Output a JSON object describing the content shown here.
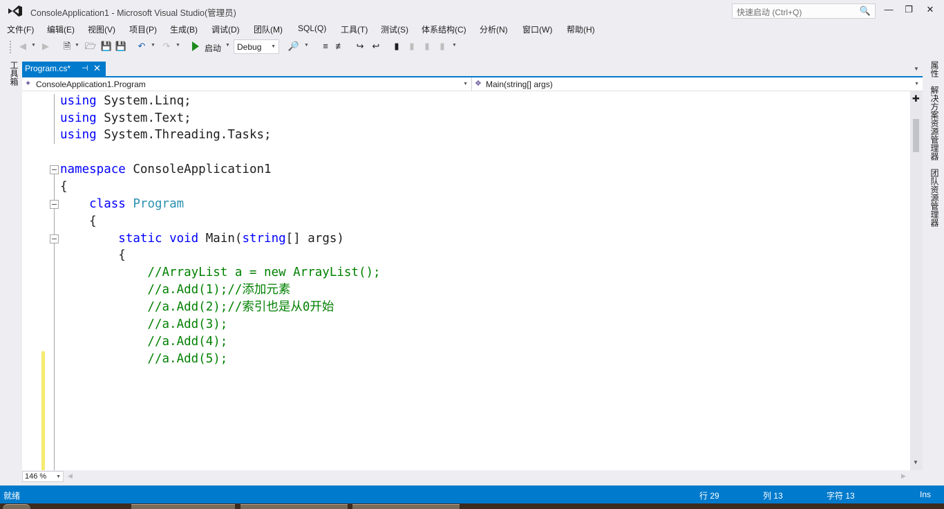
{
  "window": {
    "title": "ConsoleApplication1 - Microsoft Visual Studio(管理员)",
    "quick_launch_placeholder": "快速启动 (Ctrl+Q)",
    "minimize": "—",
    "maximize": "❐",
    "close": "✕"
  },
  "menu": [
    "文件(F)",
    "编辑(E)",
    "视图(V)",
    "项目(P)",
    "生成(B)",
    "调试(D)",
    "团队(M)",
    "SQL(Q)",
    "工具(T)",
    "测试(S)",
    "体系结构(C)",
    "分析(N)",
    "窗口(W)",
    "帮助(H)"
  ],
  "toolbar": {
    "start_label": "启动",
    "config": "Debug"
  },
  "side": {
    "toolbox": "工具箱",
    "properties": "属性",
    "solution_explorer": "解决方案资源管理器",
    "team_explorer": "团队资源管理器"
  },
  "doc_tab": {
    "label": "Program.cs*",
    "pin": "⊣",
    "close": "✕"
  },
  "nav": {
    "type": "ConsoleApplication1.Program",
    "member": "Main(string[] args)"
  },
  "code": {
    "l1": {
      "kw": "using",
      "rest": " System.Linq;"
    },
    "l2": {
      "kw": "using",
      "rest": " System.Text;"
    },
    "l3": {
      "kw": "using",
      "rest": " System.Threading.Tasks;"
    },
    "l5": {
      "kw": "namespace",
      "rest": " ConsoleApplication1"
    },
    "l6": "{",
    "l7": {
      "indent": "    ",
      "kw": "class",
      "sp": " ",
      "type": "Program"
    },
    "l8": "    {",
    "l9": {
      "indent": "        ",
      "kw1": "static",
      "sp1": " ",
      "kw2": "void",
      "mid": " Main(",
      "kw3": "string",
      "rest": "[] args)"
    },
    "l10": "        {",
    "l11": "            //ArrayList a = new ArrayList();",
    "l12": "            //a.Add(1);//添加元素",
    "l13": "            //a.Add(2);//索引也是从0开始",
    "l14": "            //a.Add(3);",
    "l15": "            //a.Add(4);",
    "l16": "            //a.Add(5);"
  },
  "zoom": "146 %",
  "status": {
    "ready": "就绪",
    "line": "行 29",
    "col": "列 13",
    "ch": "字符 13",
    "mode": "Ins"
  },
  "colors": {
    "accent": "#007acc",
    "keyword": "#0000ff",
    "type": "#2b91af",
    "comment": "#008000"
  }
}
